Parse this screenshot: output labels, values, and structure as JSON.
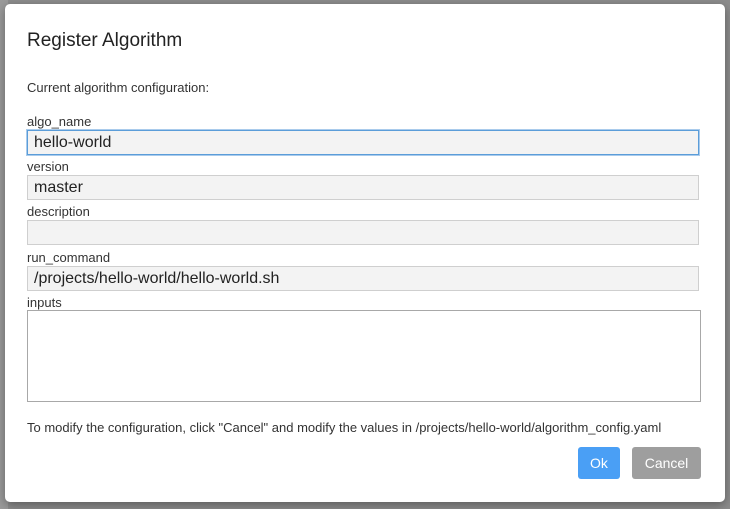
{
  "dialog": {
    "title": "Register Algorithm",
    "intro": "Current algorithm configuration:",
    "fields": {
      "algo_name": {
        "label": "algo_name",
        "value": "hello-world"
      },
      "version": {
        "label": "version",
        "value": "master"
      },
      "description": {
        "label": "description",
        "value": ""
      },
      "run_command": {
        "label": "run_command",
        "value": "/projects/hello-world/hello-world.sh"
      },
      "inputs": {
        "label": "inputs",
        "value": ""
      }
    },
    "note": "To modify the configuration, click \"Cancel\" and modify the values in /projects/hello-world/algorithm_config.yaml",
    "buttons": {
      "ok": "Ok",
      "cancel": "Cancel"
    }
  },
  "colors": {
    "ok_button": "#4a9ff5",
    "cancel_button": "#9e9e9e",
    "focus_border": "#5b9dd9",
    "field_background": "#f3f3f3"
  }
}
